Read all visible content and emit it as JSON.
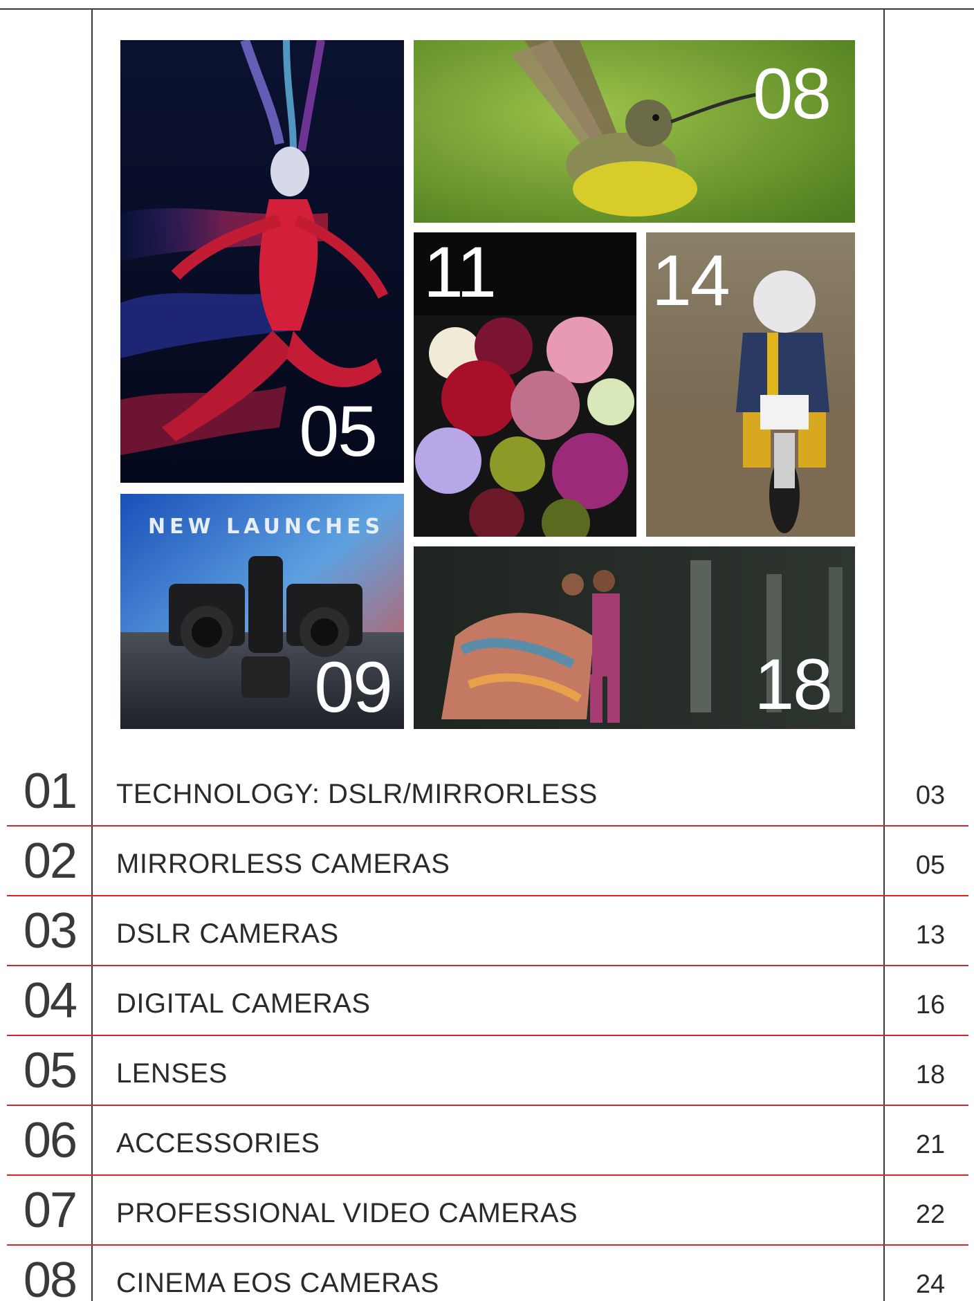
{
  "collage": {
    "tiles": [
      {
        "name": "tile-dancer",
        "number": "05"
      },
      {
        "name": "tile-hummingbird",
        "number": "08"
      },
      {
        "name": "tile-flowers",
        "number": "11"
      },
      {
        "name": "tile-motocross",
        "number": "14"
      },
      {
        "name": "tile-new-launches",
        "number": "09",
        "headline": "NEW LAUNCHES"
      },
      {
        "name": "tile-couple",
        "number": "18"
      }
    ]
  },
  "toc": [
    {
      "number": "01",
      "title": "TECHNOLOGY: DSLR/MIRRORLESS",
      "page": "03"
    },
    {
      "number": "02",
      "title": "MIRRORLESS CAMERAS",
      "page": "05"
    },
    {
      "number": "03",
      "title": "DSLR CAMERAS",
      "page": "13"
    },
    {
      "number": "04",
      "title": "DIGITAL CAMERAS",
      "page": "16"
    },
    {
      "number": "05",
      "title": "LENSES",
      "page": "18"
    },
    {
      "number": "06",
      "title": "ACCESSORIES",
      "page": "21"
    },
    {
      "number": "07",
      "title": "PROFESSIONAL VIDEO CAMERAS",
      "page": "22"
    },
    {
      "number": "08",
      "title": "CINEMA EOS CAMERAS",
      "page": "24"
    }
  ],
  "colors": {
    "accent_rule": "#d8242b",
    "frame_line": "#3a3a3a"
  }
}
